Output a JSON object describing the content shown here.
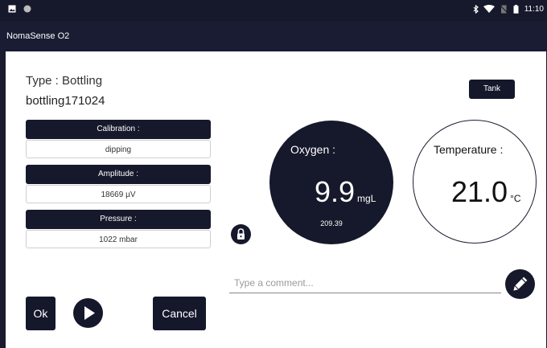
{
  "status_bar": {
    "left_icons": [
      "image-icon",
      "circle-icon"
    ],
    "right_icons": [
      "bluetooth-icon",
      "wifi-icon",
      "no-sim-icon",
      "battery-icon"
    ],
    "time": "11:10"
  },
  "app": {
    "title": "NomaSense O2"
  },
  "measurement": {
    "type_label": "Type : Bottling",
    "name": "bottling171024",
    "tank_button": "Tank"
  },
  "fields": [
    {
      "label": "Calibration :",
      "value": "dipping"
    },
    {
      "label": "Amplitude :",
      "value": "18669 µV"
    },
    {
      "label": "Pressure :",
      "value": "1022 mbar"
    }
  ],
  "oxygen": {
    "label": "Oxygen :",
    "value": "9.9",
    "unit": "mgL",
    "sub_value": "209.39"
  },
  "temperature": {
    "label": "Temperature :",
    "value": "21.0",
    "unit": "°C"
  },
  "comment": {
    "placeholder": "Type a comment...",
    "value": ""
  },
  "actions": {
    "ok_label": "Ok",
    "cancel_label": "Cancel"
  },
  "colors": {
    "primary_dark": "#16182b",
    "background": "#ffffff"
  },
  "icons": {
    "lock": "lock-icon",
    "edit": "pencil-icon",
    "play": "play-icon"
  }
}
